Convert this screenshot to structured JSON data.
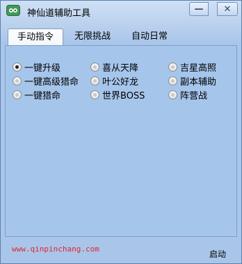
{
  "window": {
    "title": "神仙道辅助工具"
  },
  "controls": {
    "minimize": "—",
    "close": "✕"
  },
  "tabs": [
    {
      "label": "手动指令",
      "active": true
    },
    {
      "label": "无限挑战",
      "active": false
    },
    {
      "label": "自动日常",
      "active": false
    }
  ],
  "options": [
    {
      "label": "一键升级",
      "checked": true
    },
    {
      "label": "喜从天降",
      "checked": false
    },
    {
      "label": "吉星高照",
      "checked": false
    },
    {
      "label": "一键高级猎命",
      "checked": false
    },
    {
      "label": "叶公好龙",
      "checked": false
    },
    {
      "label": "副本辅助",
      "checked": false
    },
    {
      "label": "一键猎命",
      "checked": false
    },
    {
      "label": "世界BOSS",
      "checked": false
    },
    {
      "label": "阵营战",
      "checked": false
    }
  ],
  "footer": {
    "url": "www.qinpinchang.com",
    "start_label": "启动"
  },
  "colors": {
    "url_color": "#e0262b",
    "panel": "#a6c5eb"
  }
}
